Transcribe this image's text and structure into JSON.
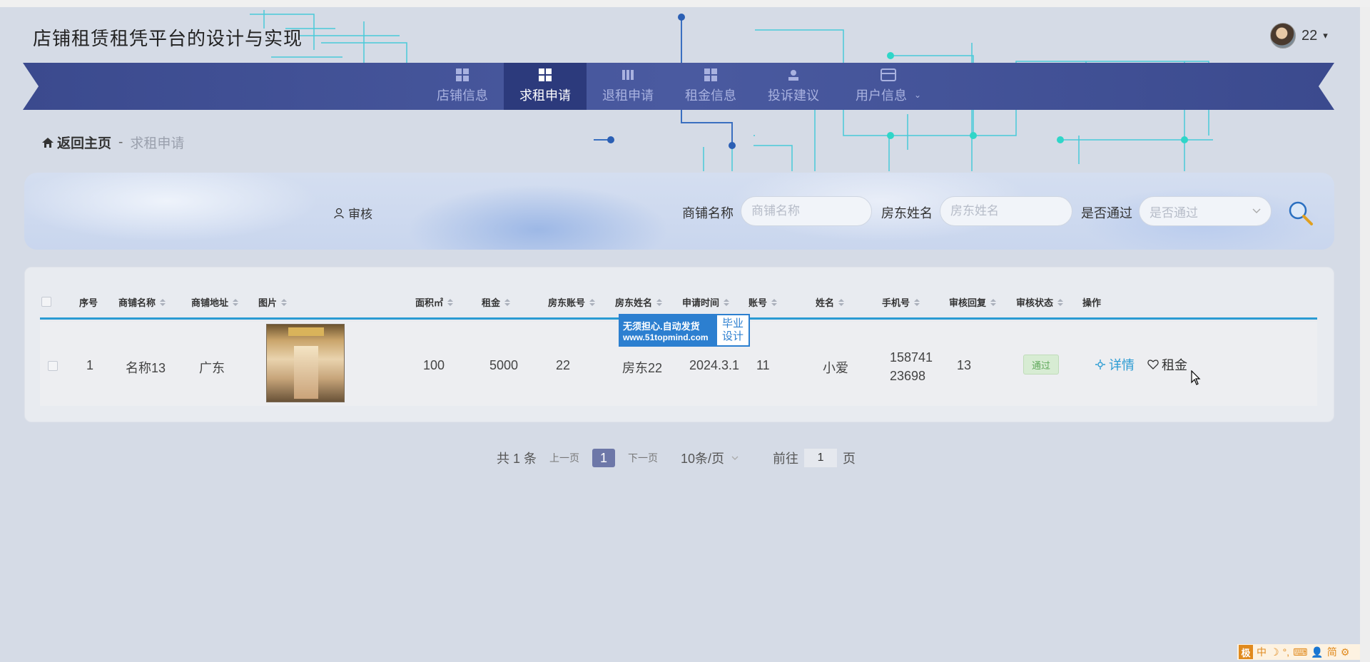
{
  "app": {
    "title": "店铺租赁租凭平台的设计与实现"
  },
  "user": {
    "name": "22",
    "caret": "▾"
  },
  "nav": {
    "items": [
      {
        "label": "店铺信息",
        "icon": "grid-icon"
      },
      {
        "label": "求租申请",
        "icon": "grid-icon",
        "active": true
      },
      {
        "label": "退租申请",
        "icon": "book-icon"
      },
      {
        "label": "租金信息",
        "icon": "grid-icon"
      },
      {
        "label": "投诉建议",
        "icon": "user-icon"
      },
      {
        "label": "用户信息",
        "icon": "card-icon",
        "chevron": "⌄"
      }
    ]
  },
  "breadcrumb": {
    "home": "返回主页",
    "separator": "-",
    "current": "求租申请"
  },
  "search": {
    "audit_label": "审核",
    "shop_name_label": "商铺名称",
    "shop_name_placeholder": "商铺名称",
    "landlord_label": "房东姓名",
    "landlord_placeholder": "房东姓名",
    "passed_label": "是否通过",
    "passed_placeholder": "是否通过"
  },
  "table": {
    "columns": [
      "序号",
      "商铺名称",
      "商铺地址",
      "图片",
      "面积㎡",
      "租金",
      "房东账号",
      "房东姓名",
      "申请时间",
      "账号",
      "姓名",
      "手机号",
      "审核回复",
      "审核状态",
      "操作"
    ],
    "rows": [
      {
        "index": "1",
        "shop_name": "名称13",
        "address": "广东",
        "area": "100",
        "rent": "5000",
        "landlord_account": "22",
        "landlord_name": "房东22",
        "apply_time": "2024.3.1",
        "account": "11",
        "name": "小爱",
        "phone_line1": "158741",
        "phone_line2": "23698",
        "audit_reply": "13",
        "status": "通过",
        "op_detail": "详情",
        "op_rent": "租金"
      }
    ]
  },
  "watermark": {
    "line1": "无须担心.自动发货",
    "line2": "www.51topmind.com",
    "right1": "毕业",
    "right2": "设计"
  },
  "pagination": {
    "total": "共 1 条",
    "prev": "上一页",
    "current": "1",
    "next": "下一页",
    "page_size": "10条/页",
    "jump_label": "前往",
    "jump_value": "1",
    "jump_suffix": "页"
  },
  "ime": {
    "logo": "极",
    "items": [
      "中",
      "☽",
      "°,",
      "⌨",
      "👤",
      "简",
      "⚙"
    ]
  },
  "colors": {
    "nav_bg": "#3b4a8e",
    "nav_active": "#2c3a7c",
    "accent": "#2a9bd3",
    "pass_text": "#5ea85a"
  }
}
